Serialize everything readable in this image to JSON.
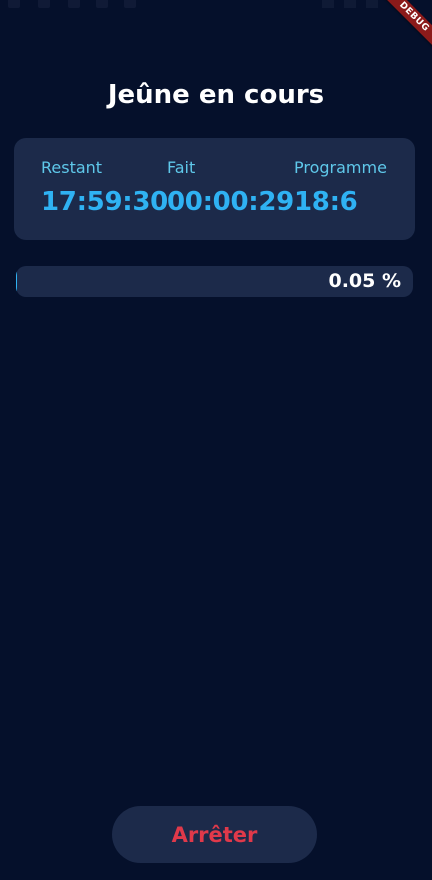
{
  "app": {
    "debug_banner": "DEBUG"
  },
  "header": {
    "title": "Jeûne en cours"
  },
  "stats": [
    {
      "label": "Restant",
      "value": "17:59:30"
    },
    {
      "label": "Fait",
      "value": "00:00:29"
    },
    {
      "label": "Programme",
      "value": "18:6"
    }
  ],
  "progress": {
    "percent": 0.05,
    "label": "0.05 %"
  },
  "actions": {
    "stop_label": "Arrêter"
  },
  "colors": {
    "background": "#05102b",
    "card": "#1c2a4a",
    "label": "#5fc8ea",
    "value": "#2fb2f3",
    "stop": "#e0394a"
  }
}
